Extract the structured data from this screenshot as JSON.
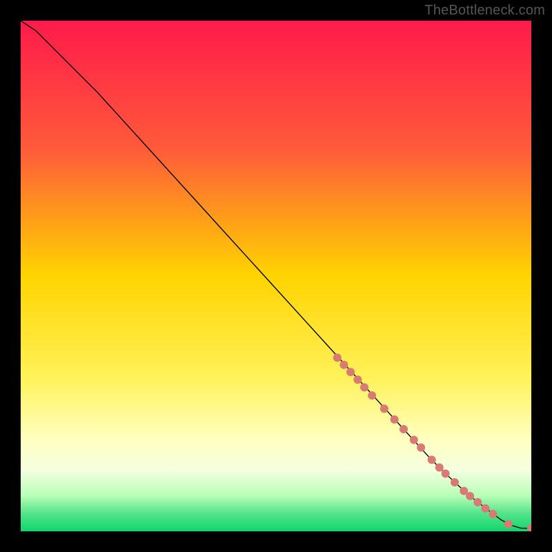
{
  "watermark": "TheBottleneck.com",
  "chart_data": {
    "type": "line",
    "title": "",
    "xlabel": "",
    "ylabel": "",
    "xlim": [
      0,
      100
    ],
    "ylim": [
      0,
      100
    ],
    "grid": false,
    "legend": false,
    "gradient_stops": [
      {
        "offset": 0.0,
        "color": "#ff1a4b"
      },
      {
        "offset": 0.25,
        "color": "#ff5a3a"
      },
      {
        "offset": 0.5,
        "color": "#ffd400"
      },
      {
        "offset": 0.7,
        "color": "#fff25a"
      },
      {
        "offset": 0.82,
        "color": "#ffffc0"
      },
      {
        "offset": 0.88,
        "color": "#f5ffe0"
      },
      {
        "offset": 0.93,
        "color": "#b8ffb8"
      },
      {
        "offset": 0.965,
        "color": "#55e28a"
      },
      {
        "offset": 1.0,
        "color": "#0fd66b"
      }
    ],
    "series": [
      {
        "name": "curve",
        "stroke": "#000000",
        "stroke_width": 1.4,
        "x": [
          0,
          3,
          6,
          10,
          15,
          20,
          25,
          30,
          35,
          40,
          45,
          50,
          55,
          60,
          65,
          70,
          75,
          80,
          83,
          86,
          89,
          92,
          94,
          96,
          98,
          100
        ],
        "y": [
          100,
          98,
          95,
          91,
          86,
          80.5,
          75,
          69.5,
          64,
          58.5,
          53,
          47.5,
          42,
          36.5,
          31,
          25.5,
          20,
          14.5,
          11.5,
          8.7,
          6.1,
          3.8,
          2.3,
          1.2,
          0.6,
          0.6
        ]
      }
    ],
    "markers": {
      "color": "#d97a74",
      "radius": 6,
      "points": [
        {
          "x": 62.0,
          "y": 34.0
        },
        {
          "x": 63.3,
          "y": 32.6
        },
        {
          "x": 64.6,
          "y": 31.2
        },
        {
          "x": 66.0,
          "y": 29.7
        },
        {
          "x": 67.3,
          "y": 28.2
        },
        {
          "x": 68.8,
          "y": 26.6
        },
        {
          "x": 71.2,
          "y": 24.0
        },
        {
          "x": 73.2,
          "y": 21.9
        },
        {
          "x": 75.0,
          "y": 20.0
        },
        {
          "x": 77.0,
          "y": 17.9
        },
        {
          "x": 78.4,
          "y": 16.4
        },
        {
          "x": 80.5,
          "y": 14.0
        },
        {
          "x": 82.0,
          "y": 12.5
        },
        {
          "x": 83.2,
          "y": 11.3
        },
        {
          "x": 85.0,
          "y": 9.6
        },
        {
          "x": 86.8,
          "y": 7.9
        },
        {
          "x": 88.0,
          "y": 6.9
        },
        {
          "x": 89.5,
          "y": 5.7
        },
        {
          "x": 91.0,
          "y": 4.5
        },
        {
          "x": 92.5,
          "y": 3.4
        },
        {
          "x": 95.5,
          "y": 1.4
        },
        {
          "x": 100.0,
          "y": 0.6
        }
      ]
    }
  }
}
